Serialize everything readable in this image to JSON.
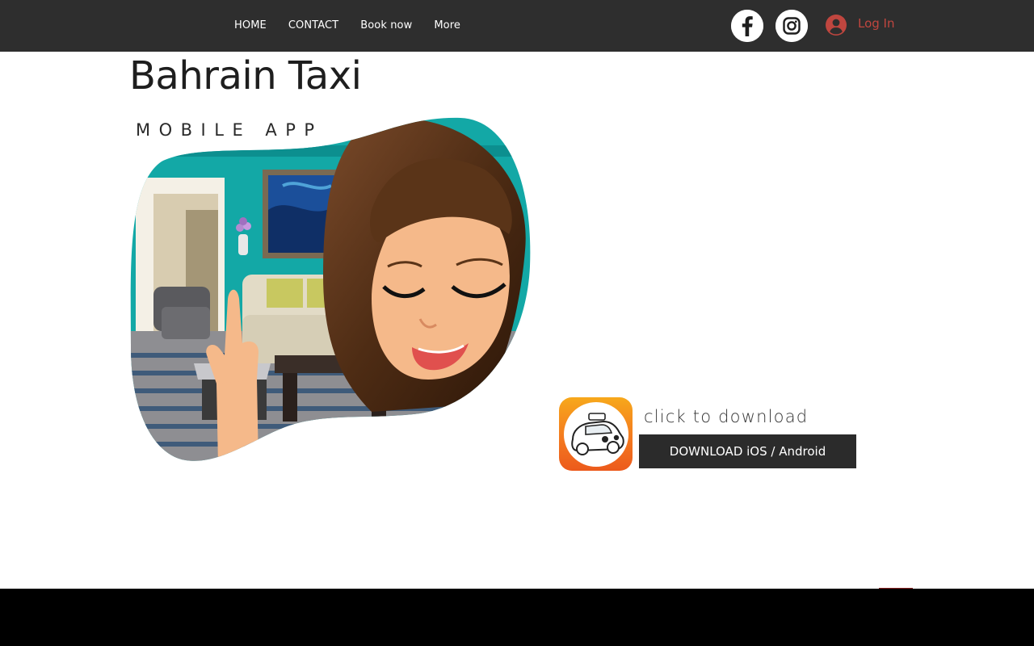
{
  "header": {
    "nav": [
      {
        "label": "HOME"
      },
      {
        "label": "CONTACT"
      },
      {
        "label": "Book now"
      },
      {
        "label": "More"
      }
    ],
    "social": [
      {
        "icon": "facebook-icon"
      },
      {
        "icon": "instagram-icon"
      }
    ],
    "login": {
      "icon": "user-avatar-icon",
      "label": "Log In",
      "color": "#c0463f"
    }
  },
  "hero": {
    "title": "Bahrain Taxi",
    "subtitle": "MOBILE APP",
    "image": "cartoon-woman-pointing-illustration"
  },
  "download": {
    "app_icon": "taxi-car-app-icon",
    "caption": "click to download",
    "button_label": "DOWNLOAD iOS / Android"
  },
  "colors": {
    "header_bg": "#2e2e2e",
    "button_bg": "#2b2b2b",
    "footer_bg": "#000000",
    "accent": "#c0463f"
  }
}
